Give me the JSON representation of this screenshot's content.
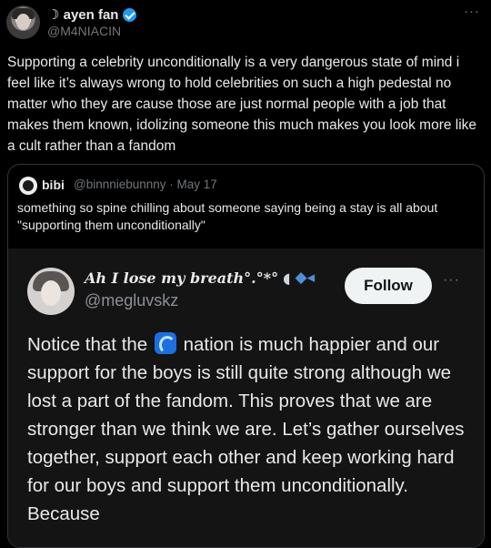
{
  "tweet": {
    "display_name": "☽ ayen fan",
    "handle": "@M4NIACIN",
    "more_label": "···",
    "text": "Supporting a celebrity unconditionally is a very dangerous state of mind i feel like it’s always wrong to hold celebrities on such a high pedestal no matter who they are cause those are just normal people with a job that makes them known, idolizing someone this much makes you look more like a cult rather than a fandom"
  },
  "quote": {
    "display_name": "bibi",
    "handle_date": "@binnniebunnny · May 17",
    "text": "something so spine chilling about someone saying being a stay is all about \"supporting them unconditionally\""
  },
  "inner": {
    "display_name": "Ah I lose my breath°.°*°",
    "handle": "@megluvskz",
    "follow_label": "Follow",
    "more_label": "···",
    "text_before_icon": "Notice that the ",
    "text_after_icon": " nation is much happier and our support for the boys is still quite strong although we lost a part of the fandom. This proves that we are stronger than we think we are. Let’s gather ourselves together, support each other and keep working hard for our boys and support them unconditionally. Because"
  },
  "icons": {
    "verified": "verified-badge-icon",
    "wave": "wave-emoji-icon",
    "shell": "shell-emoji-icon",
    "fish": "fish-emoji-icon"
  },
  "colors": {
    "background": "#000000",
    "text": "#e7e9ea",
    "muted": "#71767b",
    "verified": "#1d9bf0",
    "border": "#333639"
  }
}
